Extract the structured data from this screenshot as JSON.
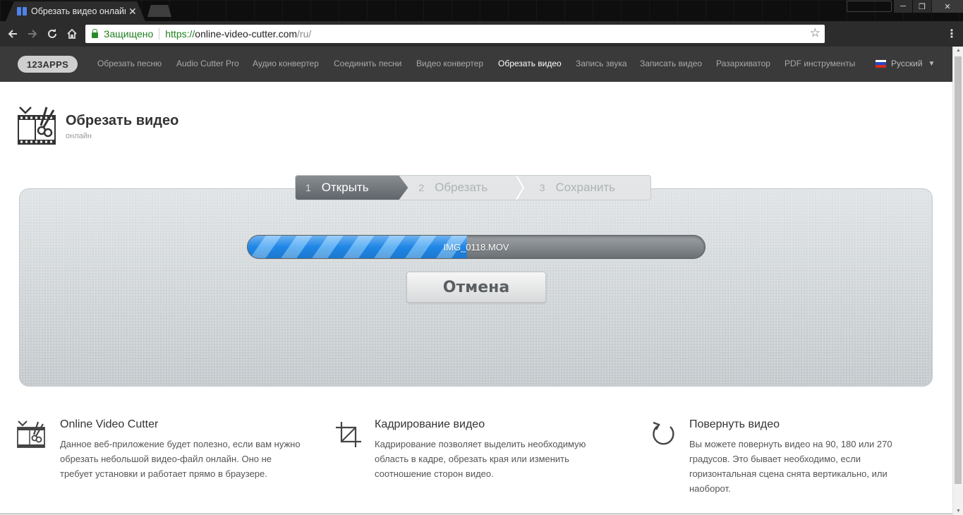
{
  "browser": {
    "tab_title": "Обрезать видео онлайн",
    "tab_close": "✕",
    "security_label": "Защищено",
    "url": {
      "protocol": "https://",
      "host": "online-video-cutter.com",
      "path": "/ru/"
    },
    "icons": {
      "back": "arrow-left",
      "forward": "arrow-right",
      "reload": "reload",
      "home": "home",
      "star": "star",
      "menu": "vertical-dots"
    }
  },
  "nav": {
    "logo": "123APPS",
    "links": [
      "Обрезать песню",
      "Audio Cutter Pro",
      "Аудио конвертер",
      "Соединить песни",
      "Видео конвертер",
      "Обрезать видео",
      "Запись звука",
      "Записать видео",
      "Разархиватор",
      "PDF инструменты"
    ],
    "active_index": 5,
    "language": "Русский"
  },
  "header": {
    "title": "Обрезать видео",
    "subtitle": "онлайн"
  },
  "steps": [
    {
      "num": "1",
      "label": "Открыть",
      "state": "active"
    },
    {
      "num": "2",
      "label": "Обрезать",
      "state": "inactive"
    },
    {
      "num": "3",
      "label": "Сохранить",
      "state": "inactive"
    }
  ],
  "upload": {
    "filename": "IMG_0118.MOV",
    "progress": 0.48,
    "cancel_label": "Отмена"
  },
  "features": [
    {
      "icon": "film-scissors-icon",
      "title": "Online Video Cutter",
      "desc": "Данное веб-приложение будет полезно, если вам нужно обрезать небольшой видео-файл онлайн. Оно не требует установки и работает прямо в браузере."
    },
    {
      "icon": "crop-icon",
      "title": "Кадрирование видео",
      "desc": "Кадрирование позволяет выделить необходимую область в кадре, обрезать края или изменить соотношение сторон видео."
    },
    {
      "icon": "rotate-icon",
      "title": "Повернуть видео",
      "desc": "Вы можете повернуть видео на 90, 180 или 270 градусов. Это бывает необходимо, если горизонтальная сцена снята вертикально, или наоборот."
    }
  ],
  "colors": {
    "nav_bg": "#3a3a3a",
    "progress_blue": "#1f86e6",
    "secure_green": "#1e7e1e",
    "step_active": "#6c7277"
  }
}
